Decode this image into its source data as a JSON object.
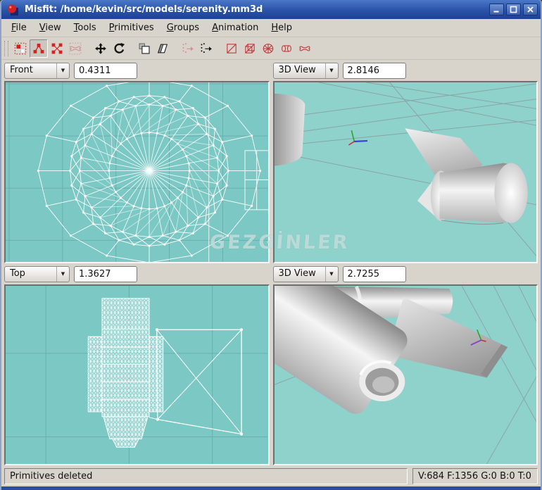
{
  "window": {
    "title": "Misfit: /home/kevin/src/models/serenity.mm3d"
  },
  "titlebar": {
    "buttons": [
      {
        "name": "minimize"
      },
      {
        "name": "maximize"
      },
      {
        "name": "close"
      }
    ]
  },
  "menu": {
    "items": [
      {
        "label": "File"
      },
      {
        "label": "View"
      },
      {
        "label": "Tools"
      },
      {
        "label": "Primitives"
      },
      {
        "label": "Groups"
      },
      {
        "label": "Animation"
      },
      {
        "label": "Help"
      }
    ]
  },
  "toolbar": {
    "buttons": [
      {
        "icon": "select-vertices",
        "state": "normal",
        "gap": false
      },
      {
        "icon": "select-connected",
        "state": "pressed",
        "gap": false
      },
      {
        "icon": "select-faces",
        "state": "normal",
        "gap": false
      },
      {
        "icon": "select-bone-joints",
        "state": "disabled",
        "gap": false
      },
      {
        "icon": "move",
        "state": "normal",
        "gap": true
      },
      {
        "icon": "rotate",
        "state": "normal",
        "gap": false
      },
      {
        "icon": "extrude",
        "state": "normal",
        "gap": true
      },
      {
        "icon": "shear",
        "state": "normal",
        "gap": false
      },
      {
        "icon": "move-vertices",
        "state": "disabled",
        "gap": true
      },
      {
        "icon": "move-points",
        "state": "normal",
        "gap": false
      },
      {
        "icon": "create-rectangle",
        "state": "normal",
        "gap": true
      },
      {
        "icon": "create-cube",
        "state": "normal",
        "gap": false
      },
      {
        "icon": "create-sphere",
        "state": "normal",
        "gap": false
      },
      {
        "icon": "create-cylinder",
        "state": "normal",
        "gap": false
      },
      {
        "icon": "create-bone",
        "state": "normal",
        "gap": false
      }
    ]
  },
  "viewports": [
    {
      "view": "Front",
      "zoom": "0.4311"
    },
    {
      "view": "3D View",
      "zoom": "2.8146"
    },
    {
      "view": "Top",
      "zoom": "1.3627"
    },
    {
      "view": "3D View",
      "zoom": "2.7255"
    }
  ],
  "statusbar": {
    "message": "Primitives deleted",
    "stats": "V:684 F:1356 G:0 B:0 T:0"
  },
  "watermark": "GEZGİNLER",
  "colors": {
    "titlebar_blue": "#2a52a6",
    "viewport_teal_ortho": "#7cc8c4",
    "viewport_teal_3d": "#8fd2cc",
    "wireframe_white": "#ffffff",
    "toolbar_red": "#cc3333",
    "window_gray": "#d8d4cc"
  }
}
